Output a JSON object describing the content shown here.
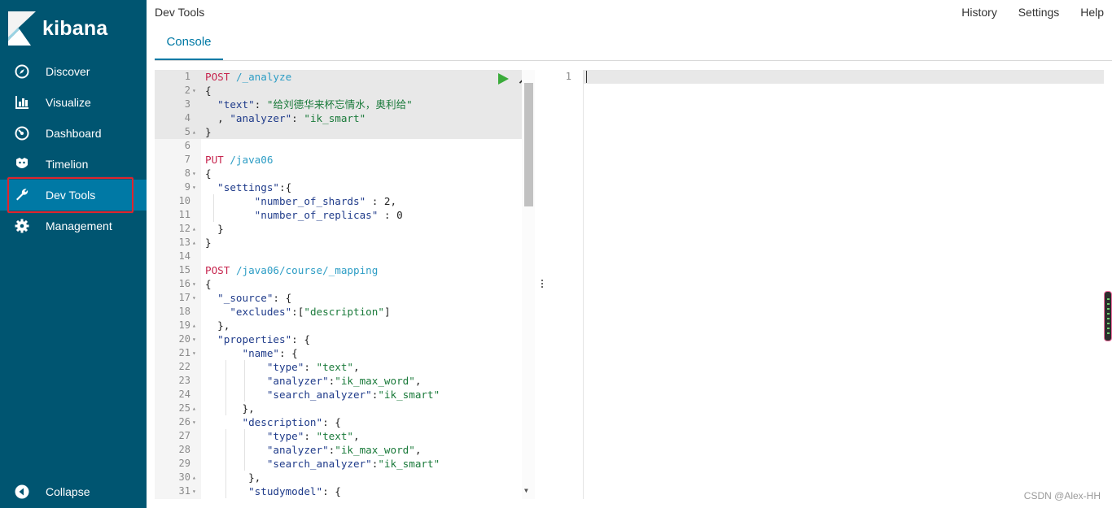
{
  "app": {
    "logo_text": "kibana",
    "title": "Dev Tools"
  },
  "sidebar": {
    "items": [
      {
        "label": "Discover",
        "icon": "compass-icon"
      },
      {
        "label": "Visualize",
        "icon": "bar-chart-icon"
      },
      {
        "label": "Dashboard",
        "icon": "dashboard-icon"
      },
      {
        "label": "Timelion",
        "icon": "timelion-icon"
      },
      {
        "label": "Dev Tools",
        "icon": "wrench-icon",
        "active": true
      },
      {
        "label": "Management",
        "icon": "gear-icon"
      }
    ],
    "collapse_label": "Collapse"
  },
  "header": {
    "links": [
      "History",
      "Settings",
      "Help"
    ]
  },
  "tabs": {
    "console": "Console"
  },
  "editor": {
    "lines": [
      {
        "n": "1",
        "fold": "",
        "code": "POST /_analyze"
      },
      {
        "n": "2",
        "fold": "▾",
        "code": "{"
      },
      {
        "n": "3",
        "fold": "",
        "code": "  \"text\": \"给刘德华来杯忘情水，奥利给\""
      },
      {
        "n": "4",
        "fold": "",
        "code": "  , \"analyzer\": \"ik_smart\""
      },
      {
        "n": "5",
        "fold": "▴",
        "code": "}"
      },
      {
        "n": "6",
        "fold": "",
        "code": ""
      },
      {
        "n": "7",
        "fold": "",
        "code": "PUT /java06"
      },
      {
        "n": "8",
        "fold": "▾",
        "code": "{"
      },
      {
        "n": "9",
        "fold": "▾",
        "code": "  \"settings\":{"
      },
      {
        "n": "10",
        "fold": "",
        "code": "        \"number_of_shards\" : 2,"
      },
      {
        "n": "11",
        "fold": "",
        "code": "        \"number_of_replicas\" : 0"
      },
      {
        "n": "12",
        "fold": "▴",
        "code": "  }"
      },
      {
        "n": "13",
        "fold": "▴",
        "code": "}"
      },
      {
        "n": "14",
        "fold": "",
        "code": ""
      },
      {
        "n": "15",
        "fold": "",
        "code": "POST /java06/course/_mapping"
      },
      {
        "n": "16",
        "fold": "▾",
        "code": "{"
      },
      {
        "n": "17",
        "fold": "▾",
        "code": "  \"_source\": {"
      },
      {
        "n": "18",
        "fold": "",
        "code": "    \"excludes\":[\"description\"]"
      },
      {
        "n": "19",
        "fold": "▴",
        "code": "  },"
      },
      {
        "n": "20",
        "fold": "▾",
        "code": "  \"properties\": {"
      },
      {
        "n": "21",
        "fold": "▾",
        "code": "      \"name\": {"
      },
      {
        "n": "22",
        "fold": "",
        "code": "          \"type\": \"text\","
      },
      {
        "n": "23",
        "fold": "",
        "code": "          \"analyzer\":\"ik_max_word\","
      },
      {
        "n": "24",
        "fold": "",
        "code": "          \"search_analyzer\":\"ik_smart\""
      },
      {
        "n": "25",
        "fold": "▴",
        "code": "      },"
      },
      {
        "n": "26",
        "fold": "▾",
        "code": "      \"description\": {"
      },
      {
        "n": "27",
        "fold": "",
        "code": "          \"type\": \"text\","
      },
      {
        "n": "28",
        "fold": "",
        "code": "          \"analyzer\":\"ik_max_word\","
      },
      {
        "n": "29",
        "fold": "",
        "code": "          \"search_analyzer\":\"ik_smart\""
      },
      {
        "n": "30",
        "fold": "▴",
        "code": "       },"
      },
      {
        "n": "31",
        "fold": "▾",
        "code": "       \"studymodel\": {"
      }
    ]
  },
  "output": {
    "line_number": "1"
  },
  "watermark": "CSDN @Alex-HH",
  "colors": {
    "sidebar": "#005571",
    "active": "#0079a5",
    "accent": "#0079a5",
    "highlight_box": "#e0242d",
    "run": "#3aab3a"
  }
}
